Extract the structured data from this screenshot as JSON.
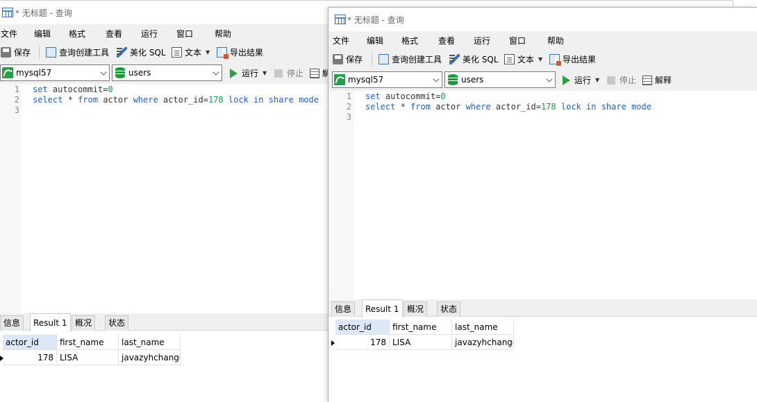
{
  "window_title": "* 无标题 - 查询",
  "menu": [
    "文件",
    "编辑",
    "格式",
    "查看",
    "运行",
    "窗口",
    "帮助"
  ],
  "toolbar": {
    "save": "保存",
    "query_builder": "查询创建工具",
    "beautify": "美化 SQL",
    "text": "文本",
    "export": "导出结果"
  },
  "connbar": {
    "connection": "mysql57",
    "database": "users",
    "run": "运行",
    "stop": "停止",
    "explain": "解释",
    "explain_truncated": "解"
  },
  "editor": {
    "line_numbers": [
      "1",
      "2",
      "3"
    ],
    "line1": {
      "kw": "set",
      "ident": "autocommit",
      "eq": "=",
      "val": "0"
    },
    "line2": {
      "select": "select",
      "star": "*",
      "from": "from",
      "table": "actor",
      "where": "where",
      "col": "actor_id",
      "eq": "=",
      "val": "178",
      "lock": "lock",
      "in": "in",
      "share": "share",
      "mode": "mode"
    }
  },
  "result_tabs": [
    "信息",
    "Result 1",
    "概况",
    "状态"
  ],
  "result": {
    "columns": [
      "actor_id",
      "first_name",
      "last_name"
    ],
    "row": [
      "178",
      "LISA",
      "javazyhchange"
    ]
  },
  "colors": {
    "keyword": "#1f5fd1",
    "number": "#11a04a",
    "header_selected": "#dce8f7",
    "run_icon": "#2ea043"
  }
}
